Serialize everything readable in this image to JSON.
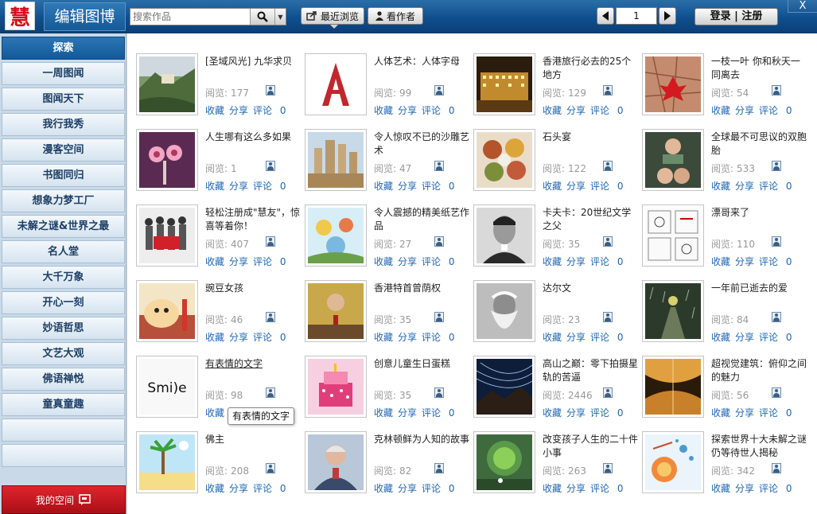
{
  "header": {
    "logo_char": "慧",
    "app_title": "编辑图博",
    "search_placeholder": "搜索作品",
    "recent_label": "最近浏览",
    "author_label": "看作者",
    "page_number": "1",
    "login_label": "登录 | 注册",
    "close_label": "X"
  },
  "sidebar": {
    "items": [
      {
        "label": "探索"
      },
      {
        "label": "一周图闻"
      },
      {
        "label": "图闻天下"
      },
      {
        "label": "我行我秀"
      },
      {
        "label": "漫客空间"
      },
      {
        "label": "书图同归"
      },
      {
        "label": "想象力梦工厂"
      },
      {
        "label": "未解之谜&世界之最"
      },
      {
        "label": "名人堂"
      },
      {
        "label": "大千万象"
      },
      {
        "label": "开心一刻"
      },
      {
        "label": "妙语哲思"
      },
      {
        "label": "文艺大观"
      },
      {
        "label": "佛语禅悦"
      },
      {
        "label": "童真童趣"
      }
    ],
    "my_space_label": "我的空间"
  },
  "labels": {
    "views": "阅览:",
    "collect": "收藏",
    "share": "分享",
    "comment": "评论"
  },
  "cards": [
    {
      "title": "[圣域风光] 九华求贝",
      "views": "177",
      "comments": "0",
      "thumb": "mountain"
    },
    {
      "title": "人体艺术：人体字母",
      "views": "99",
      "comments": "0",
      "thumb": "letter"
    },
    {
      "title": "香港旅行必去的25个地方",
      "views": "129",
      "comments": "0",
      "thumb": "night"
    },
    {
      "title": "一枝一叶 你和秋天一同离去",
      "views": "54",
      "comments": "0",
      "thumb": "leaf"
    },
    {
      "title": "人生哪有这么多如果",
      "views": "1",
      "comments": "0",
      "thumb": "hearts"
    },
    {
      "title": "令人惊叹不已的沙雕艺术",
      "views": "47",
      "comments": "0",
      "thumb": "sand"
    },
    {
      "title": "石头宴",
      "views": "122",
      "comments": "0",
      "thumb": "feast"
    },
    {
      "title": "全球最不可思议的双胞胎",
      "views": "533",
      "comments": "0",
      "thumb": "twins"
    },
    {
      "title": "轻松注册成\"慧友\"，惊喜等着你！",
      "views": "407",
      "comments": "0",
      "thumb": "group"
    },
    {
      "title": "令人震撼的精美纸艺作品",
      "views": "27",
      "comments": "0",
      "thumb": "paper"
    },
    {
      "title": "卡夫卡：20世纪文学之父",
      "views": "35",
      "comments": "0",
      "thumb": "portrait"
    },
    {
      "title": "漂哥来了",
      "views": "110",
      "comments": "0",
      "thumb": "comic"
    },
    {
      "title": "豌豆女孩",
      "views": "46",
      "comments": "0",
      "thumb": "cartoon"
    },
    {
      "title": "香港特首曾荫权",
      "views": "35",
      "comments": "0",
      "thumb": "official"
    },
    {
      "title": "达尔文",
      "views": "23",
      "comments": "0",
      "thumb": "darwin"
    },
    {
      "title": "一年前已逝去的爱",
      "views": "84",
      "comments": "0",
      "thumb": "rain"
    },
    {
      "title": "有表情的文字",
      "views": "98",
      "comments": "0",
      "thumb": "smile",
      "smile_text": "Smi)e"
    },
    {
      "title": "创意儿童生日蛋糕",
      "views": "35",
      "comments": "0",
      "thumb": "cake"
    },
    {
      "title": "高山之巅：零下拍摄星轨的苦逼",
      "views": "2446",
      "comments": "0",
      "thumb": "stars"
    },
    {
      "title": "超视觉建筑：俯仰之间的魅力",
      "views": "56",
      "comments": "0",
      "thumb": "arch"
    },
    {
      "title": "佛主",
      "views": "208",
      "comments": "0",
      "thumb": "beach"
    },
    {
      "title": "克林顿鲜为人知的故事",
      "views": "82",
      "comments": "0",
      "thumb": "clinton"
    },
    {
      "title": "改变孩子人生的二十件小事",
      "views": "263",
      "comments": "0",
      "thumb": "forest"
    },
    {
      "title": "探索世界十大未解之谜 仍等待世人揭秘",
      "views": "342",
      "comments": "0",
      "thumb": "space"
    }
  ],
  "tooltip": "有表情的文字",
  "colors": {
    "header": "#0f4f8e",
    "accent_red": "#d0111b",
    "link_blue": "#1f66b5",
    "sidebar_bg": "#c9d9e8"
  }
}
